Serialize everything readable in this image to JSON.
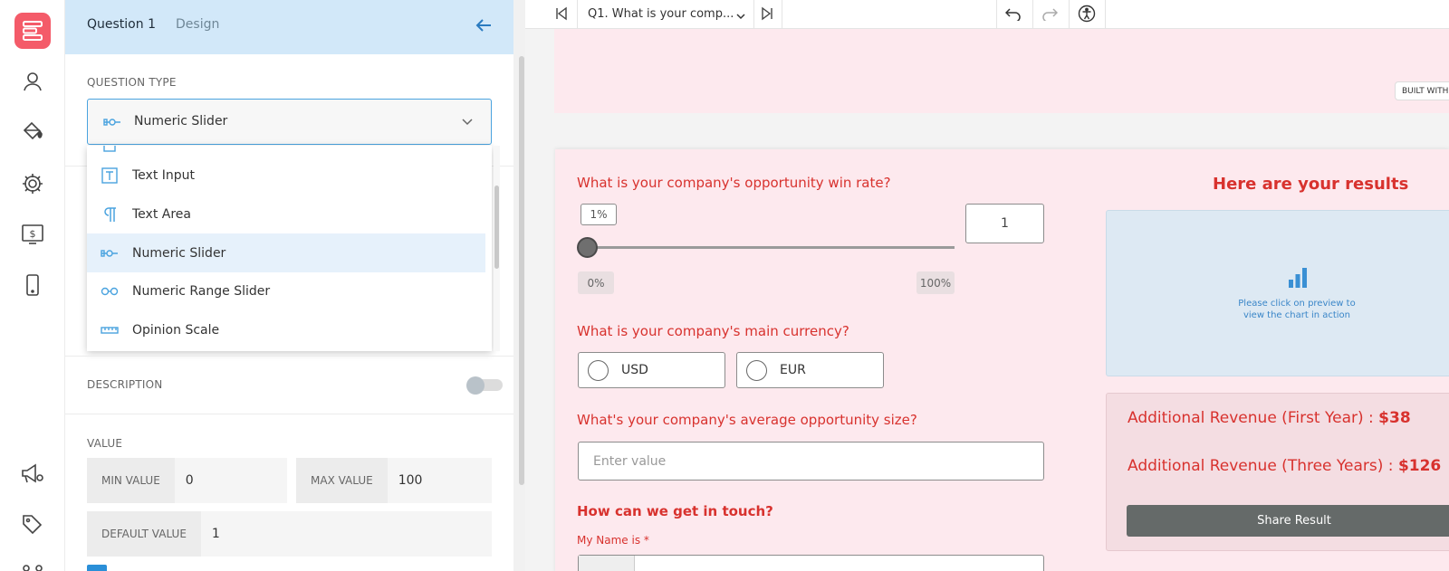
{
  "colors": {
    "brand": "#f45b69",
    "accent": "#4aa3df",
    "preview_bg": "#fde9ee",
    "question_text": "#d8322e",
    "share_button": "#656a69"
  },
  "rail": {
    "icons": [
      "logo-icon",
      "user-icon",
      "paint-bucket-icon",
      "gear-icon",
      "dollar-screen-icon",
      "mobile-icon",
      "megaphone-gear-icon",
      "tags-icon"
    ]
  },
  "panel": {
    "tabs": {
      "question": "Question 1",
      "design": "Design"
    },
    "question_type": {
      "label": "QUESTION TYPE",
      "selected": "Numeric Slider",
      "options": [
        {
          "label": "Text Input",
          "icon": "text-input-icon"
        },
        {
          "label": "Text Area",
          "icon": "paragraph-icon"
        },
        {
          "label": "Numeric Slider",
          "icon": "slider-icon"
        },
        {
          "label": "Numeric Range Slider",
          "icon": "range-slider-icon"
        },
        {
          "label": "Opinion Scale",
          "icon": "ruler-icon"
        }
      ]
    },
    "description_label": "DESCRIPTION",
    "value": {
      "label": "VALUE",
      "min_label": "MIN VALUE",
      "min_value": "0",
      "max_label": "MAX VALUE",
      "max_value": "100",
      "default_label": "DEFAULT VALUE",
      "default_value": "1"
    }
  },
  "toolbar": {
    "question_select": "Q1. What is your comp..."
  },
  "preview": {
    "built_with": "BUILT WITH",
    "q1": {
      "text": "What is your company's opportunity win rate?",
      "tooltip": "1%",
      "value": "1",
      "fraction": 0.01,
      "min_chip": "0%",
      "max_chip": "100%"
    },
    "q2": {
      "text": "What is your company's main currency?",
      "options": [
        "USD",
        "EUR"
      ]
    },
    "q3": {
      "text": "What's your company's average opportunity size?",
      "placeholder": "Enter value"
    },
    "contact": {
      "heading": "How can we get in touch?",
      "name_label": "My Name is",
      "required": "*"
    },
    "results": {
      "heading": "Here are your results",
      "chart_hint": "Please click on preview to view the chart in action",
      "rev1_label": "Additional Revenue (First Year) :",
      "rev1_value": "$38",
      "rev3_label": "Additional Revenue (Three Years) :",
      "rev3_value": "$126",
      "share": "Share Result"
    }
  }
}
